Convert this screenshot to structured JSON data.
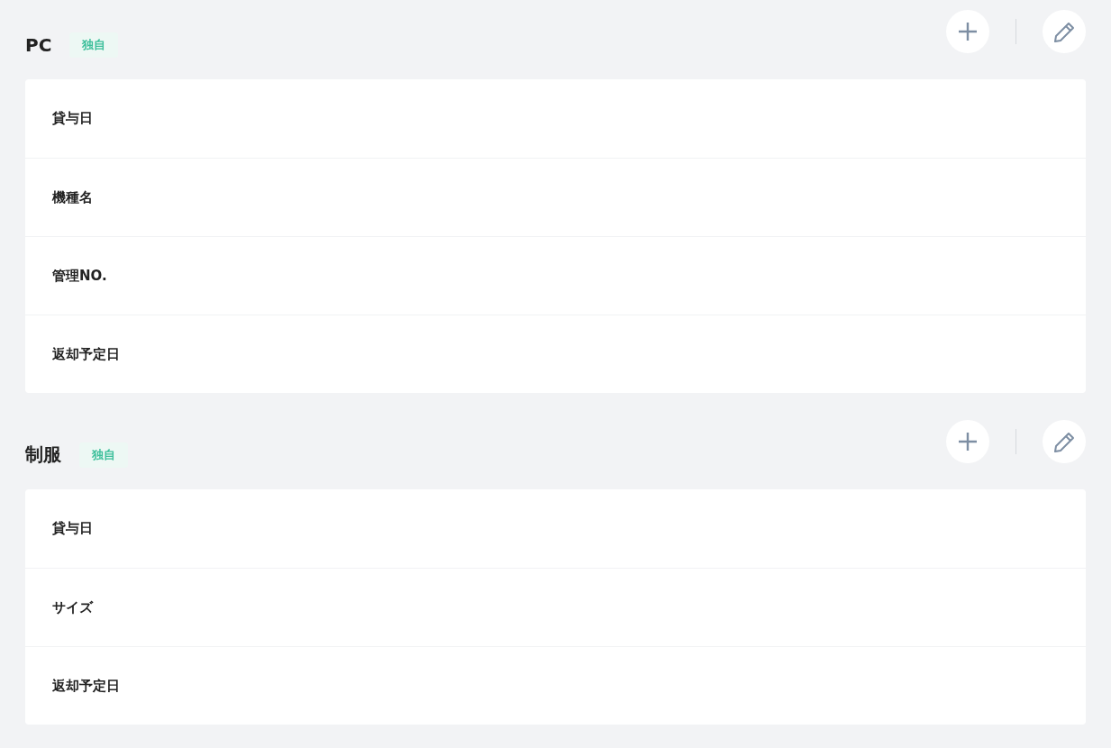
{
  "sections": [
    {
      "title": "PC",
      "badge": "独自",
      "fields": [
        "貸与日",
        "機種名",
        "管理NO.",
        "返却予定日"
      ]
    },
    {
      "title": "制服",
      "badge": "独自",
      "fields": [
        "貸与日",
        "サイズ",
        "返却予定日"
      ]
    }
  ]
}
